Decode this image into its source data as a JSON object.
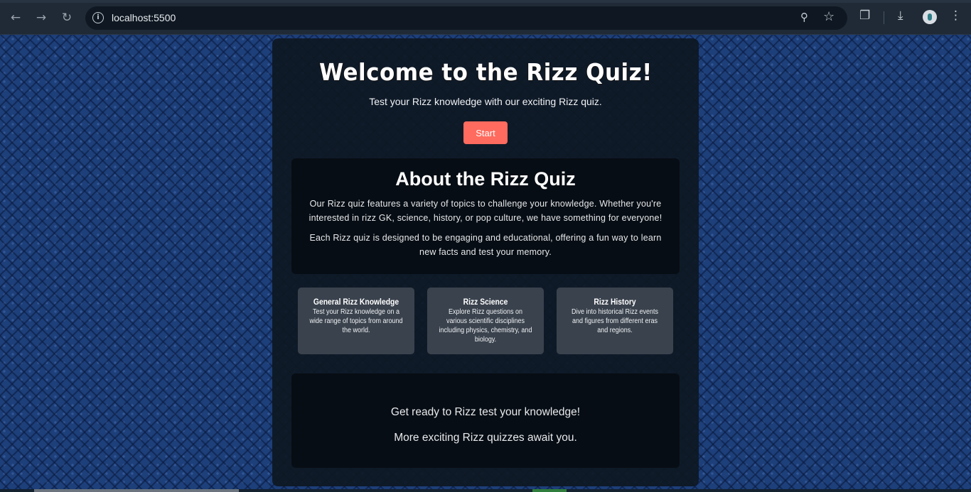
{
  "browser": {
    "url": "localhost:5500",
    "icons": {
      "back": "arrow-left-icon",
      "forward": "arrow-right-icon",
      "reload": "reload-icon",
      "info": "info-icon",
      "zoom": "zoom-icon",
      "bookmark": "star-icon",
      "extensions": "puzzle-icon",
      "download": "download-icon",
      "menu": "kebab-menu-icon"
    }
  },
  "hero": {
    "title": "Welcome to the Rizz Quiz!",
    "subtitle": "Test your Rizz knowledge with our exciting Rizz quiz.",
    "start_label": "Start"
  },
  "about": {
    "title": "About the Rizz Quiz",
    "paragraphs": [
      "Our Rizz quiz features a variety of topics to challenge your knowledge. Whether you're interested in rizz GK, science, history, or pop culture, we have something for everyone!",
      "Each Rizz quiz is designed to be engaging and educational, offering a fun way to learn new facts and test your memory."
    ]
  },
  "topics": [
    {
      "title": "General Rizz Knowledge",
      "description": "Test your Rizz knowledge on a wide range of topics from around the world."
    },
    {
      "title": "Rizz Science",
      "description": "Explore Rizz questions on various scientific disciplines including physics, chemistry, and biology."
    },
    {
      "title": "Rizz History",
      "description": "Dive into historical Rizz events and figures from different eras and regions."
    }
  ],
  "footer": {
    "line1": "Get ready to Rizz test your knowledge!",
    "line2": "More exciting Rizz quizzes await you."
  },
  "colors": {
    "accent": "#ff6b5e",
    "page_bg": "#1d3f7a",
    "card_bg": "#0e1822",
    "topic_bg": "#3a424d"
  }
}
